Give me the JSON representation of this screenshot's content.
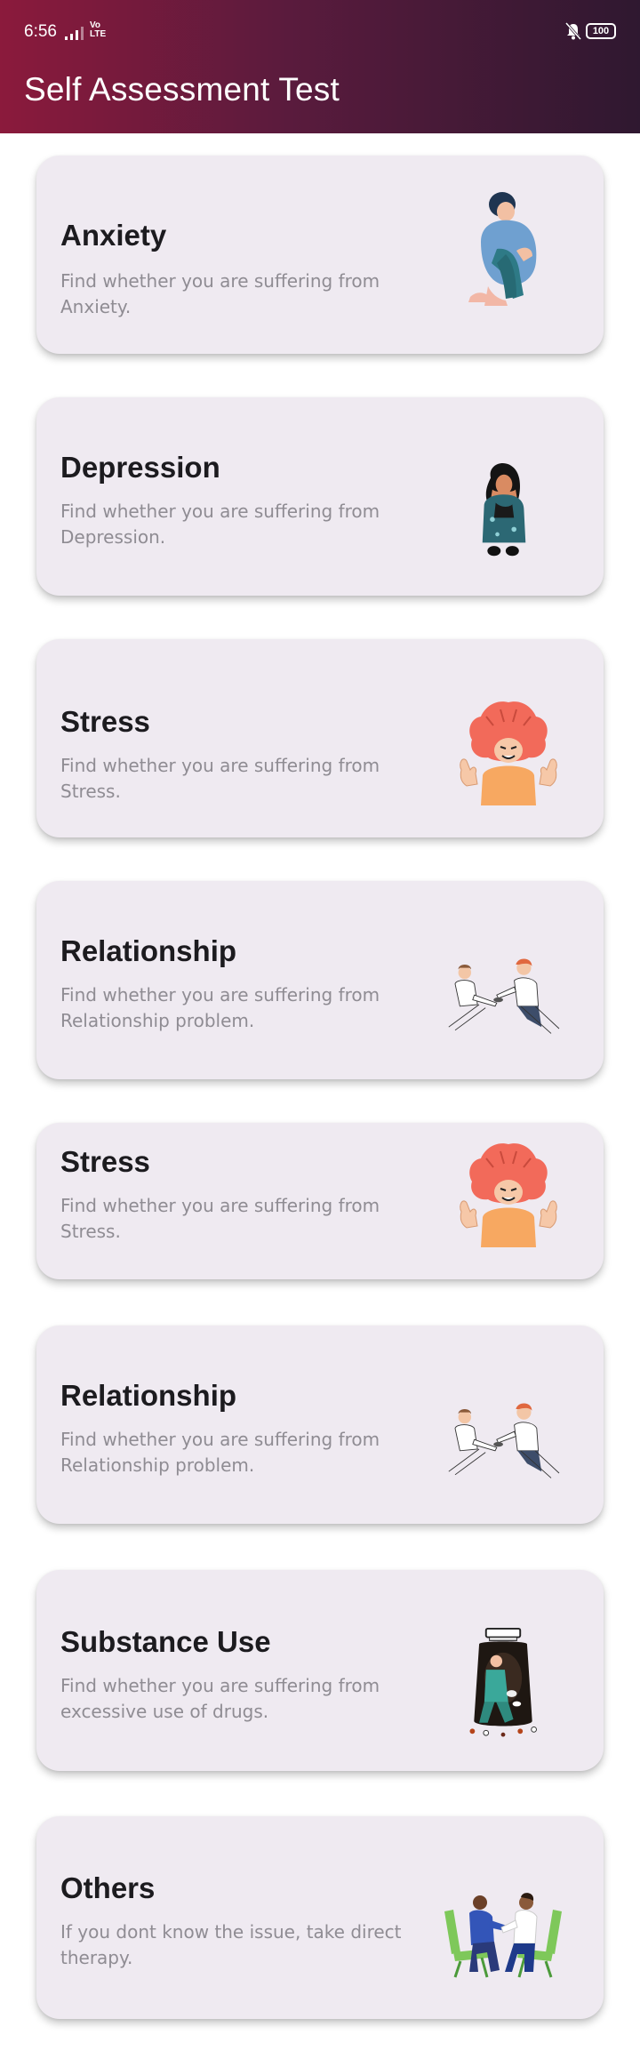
{
  "status_bar": {
    "time": "6:56",
    "network_top": "Vo",
    "network_bottom": "LTE",
    "battery": "100"
  },
  "appbar": {
    "title": "Self Assessment Test"
  },
  "colors": {
    "appbar_start": "#8b1a3c",
    "appbar_end": "#2f1830",
    "card_bg": "#efeaf1"
  },
  "cards": [
    {
      "title": "Anxiety",
      "description": "Find whether you are suffering from Anxiety.",
      "icon": "anxiety-illustration"
    },
    {
      "title": "Depression",
      "description": "Find whether you are suffering from Depression.",
      "icon": "depression-illustration"
    },
    {
      "title": "Stress",
      "description": "Find whether you are suffering from Stress.",
      "icon": "stress-illustration"
    },
    {
      "title": "Relationship",
      "description": "Find whether you are suffering from Relationship problem.",
      "icon": "relationship-illustration"
    },
    {
      "title": "Stress",
      "description": "Find whether you are suffering from Stress.",
      "icon": "stress-illustration"
    },
    {
      "title": "Relationship",
      "description": "Find whether you are suffering from Relationship problem.",
      "icon": "relationship-illustration"
    },
    {
      "title": "Substance Use",
      "description": "Find whether you are suffering from excessive use of drugs.",
      "icon": "substance-use-illustration"
    },
    {
      "title": "Others",
      "description": "If you dont know the issue, take direct therapy.",
      "icon": "therapy-illustration"
    }
  ]
}
